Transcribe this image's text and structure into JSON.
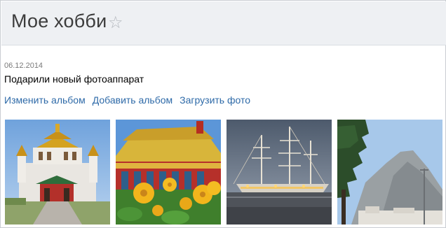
{
  "header": {
    "title": "Мое хобби",
    "star_icon": "star-outline-icon"
  },
  "album": {
    "date": "06.12.2014",
    "description": "Подарили новый фотоаппарат",
    "actions": [
      {
        "label": "Изменить альбом"
      },
      {
        "label": "Добавить альбом"
      },
      {
        "label": "Загрузить фото"
      }
    ]
  },
  "photos": [
    {
      "subject": "buddhist-temple"
    },
    {
      "subject": "pagoda-with-yellow-flowers"
    },
    {
      "subject": "tall-ship-at-dusk"
    },
    {
      "subject": "rock-and-tree"
    }
  ],
  "colors": {
    "link": "#2e6aa8",
    "header_bg": "#eef0f3",
    "title": "#3c3c3c",
    "star": "#b3b7bd",
    "date": "#7a7a7a"
  }
}
